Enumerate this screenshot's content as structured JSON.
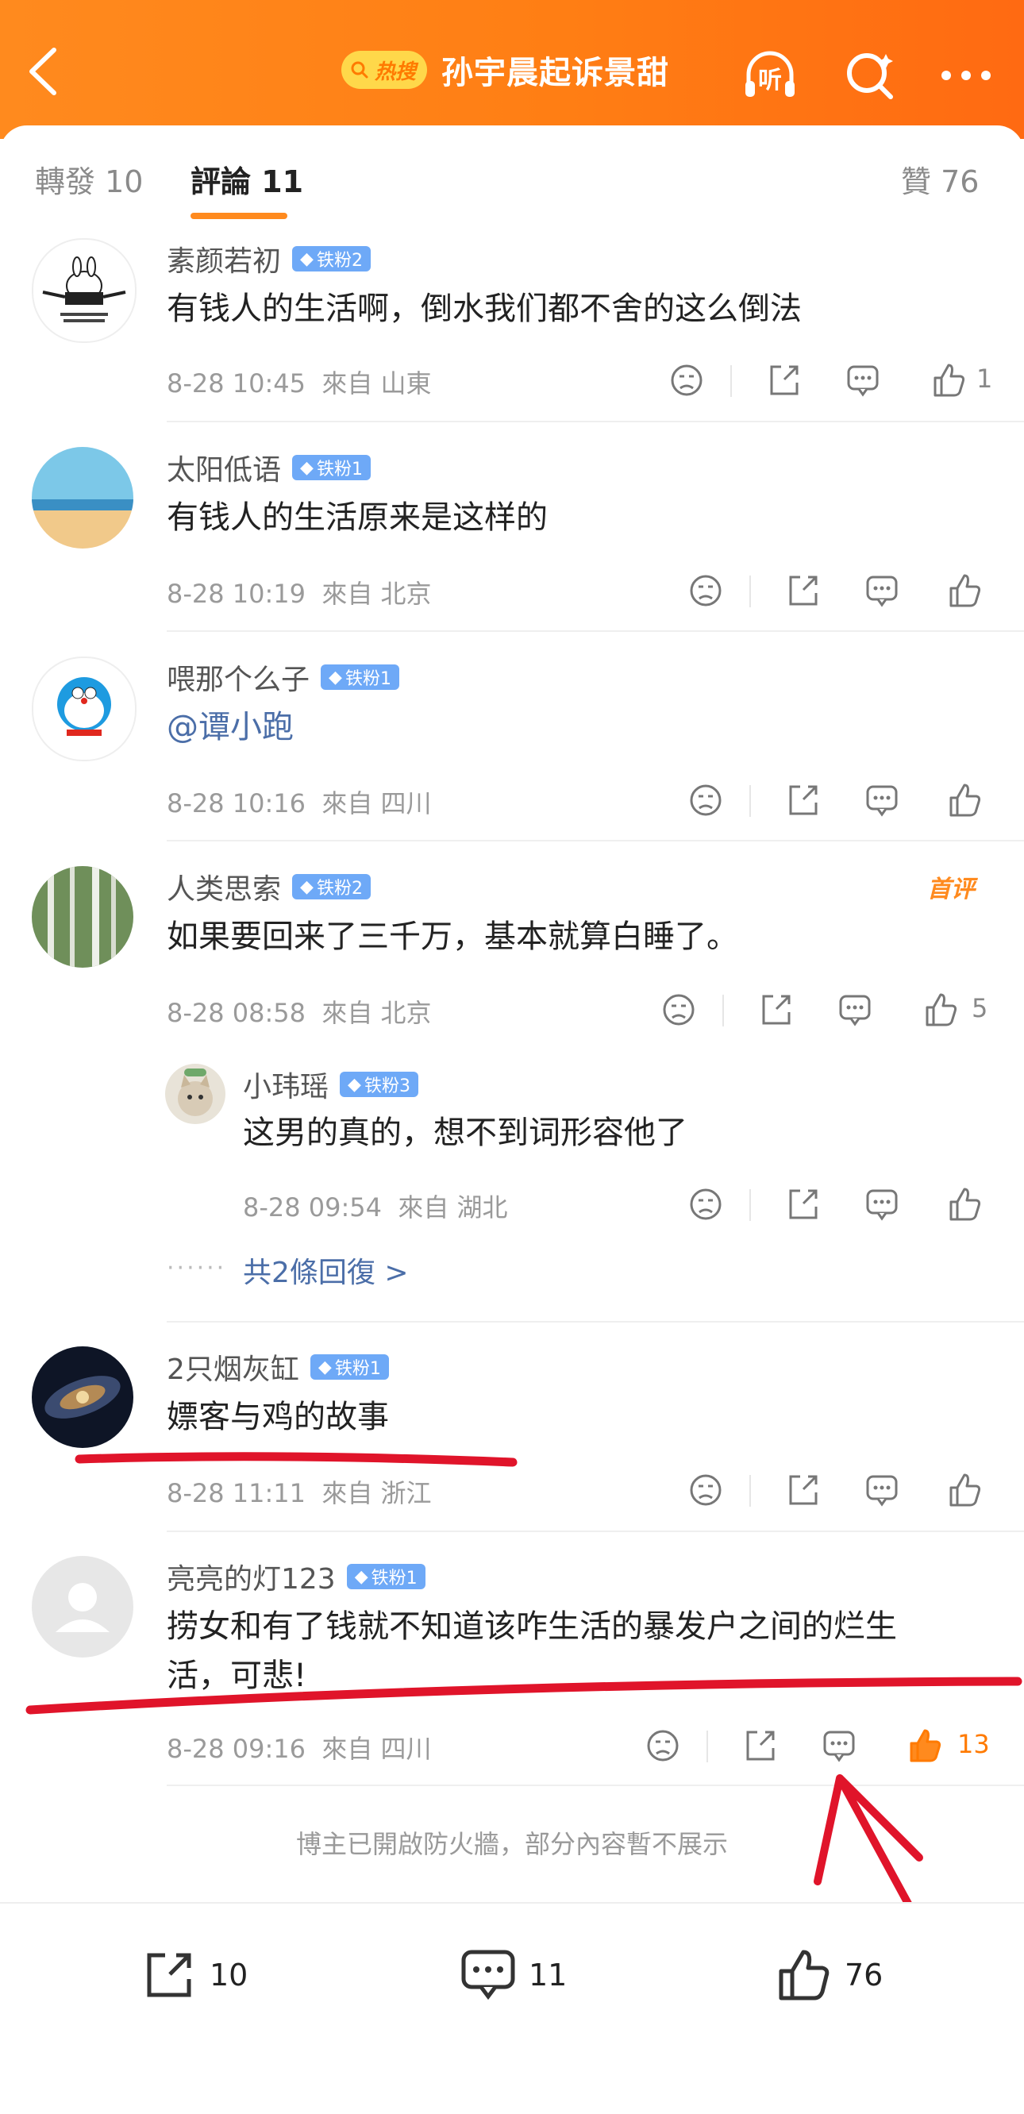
{
  "header": {
    "hot_badge": "热搜",
    "title": "孙宇晨起诉景甜",
    "listen_label": "听"
  },
  "tabs": [
    {
      "label": "轉發 10"
    },
    {
      "label": "評論 11"
    },
    {
      "label": "贊 76"
    }
  ],
  "comments": [
    {
      "user": "素颜若初",
      "badge": "铁粉2",
      "text": "有钱人的生活啊，倒水我们都不舍的这么倒法",
      "time": "8-28 10:45",
      "location": "來自 山東",
      "likes": "1",
      "avatar": "cartoon-rabbit"
    },
    {
      "user": "太阳低语",
      "badge": "铁粉1",
      "text": "有钱人的生活原来是这样的",
      "time": "8-28 10:19",
      "location": "來自 北京",
      "likes": "",
      "avatar": "beach"
    },
    {
      "user": "喂那个么子",
      "badge": "铁粉1",
      "text": "@谭小跑",
      "time": "8-28 10:16",
      "location": "來自 四川",
      "likes": "",
      "avatar": "doraemon"
    },
    {
      "user": "人类思索",
      "badge": "铁粉2",
      "text": "如果要回来了三千万，基本就算白睡了。",
      "time": "8-28 08:58",
      "location": "來自 北京",
      "likes": "5",
      "first_tag": "首评",
      "avatar": "birch-forest"
    },
    {
      "user": "2只烟灰缸",
      "badge": "铁粉1",
      "text": "嫖客与鸡的故事",
      "time": "8-28 11:11",
      "location": "來自 浙江",
      "likes": "",
      "avatar": "galaxy"
    },
    {
      "user": "亮亮的灯123",
      "badge": "铁粉1",
      "text_line1": "捞女和有了钱就不知道该咋生活的暴发户之间的烂生",
      "text_line2": "活，可悲!",
      "time": "8-28 09:16",
      "location": "來自 四川",
      "likes": "13",
      "avatar": "default-person"
    }
  ],
  "reply": {
    "user": "小玮瑶",
    "badge": "铁粉3",
    "text": "这男的真的，想不到词形容他了",
    "time": "8-28 09:54",
    "location": "來自 湖北",
    "avatar": "cat"
  },
  "more_replies": {
    "dots": "······",
    "label": "共2條回復 >"
  },
  "firewall_notice": "博主已開啟防火牆，部分內容暫不展示",
  "bottom_bar": {
    "reposts": "10",
    "comments": "11",
    "likes": "76"
  },
  "colors": {
    "accent": "#ff8a1e",
    "badge": "#6ea9f7",
    "annotation": "#e0142a",
    "mention": "#4b6ea8"
  }
}
